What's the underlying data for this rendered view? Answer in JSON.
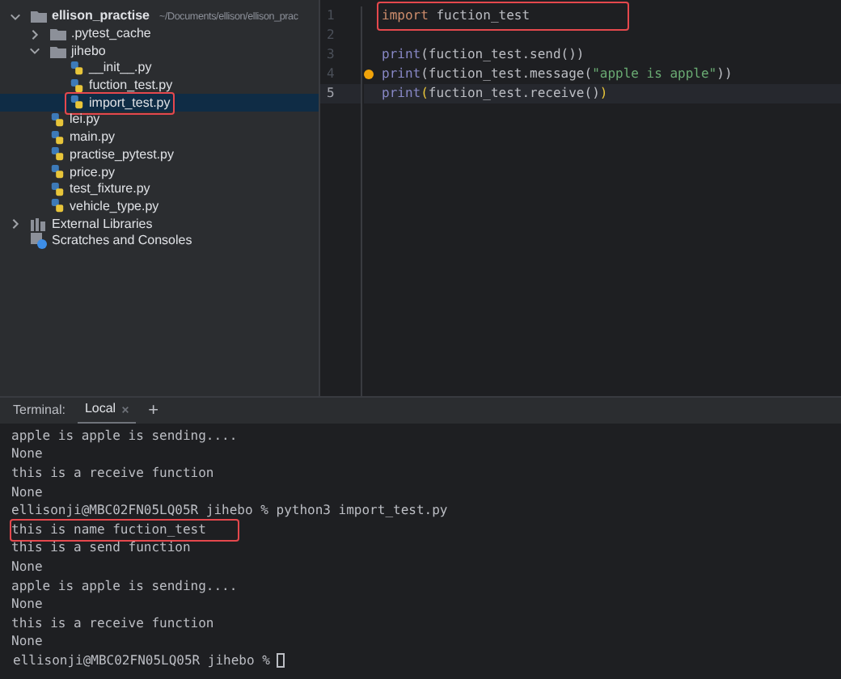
{
  "project_tree": {
    "items": [
      {
        "kind": "folder",
        "label": "ellison_practise",
        "path": "~/Documents/ellison/ellison_prac",
        "expanded": true,
        "selected": false,
        "highlighted": false,
        "children": [
          {
            "kind": "folder",
            "label": ".pytest_cache",
            "expanded": false,
            "selected": false,
            "highlighted": false
          },
          {
            "kind": "folder",
            "label": "jihebo",
            "expanded": true,
            "selected": false,
            "highlighted": false,
            "children": [
              {
                "kind": "python",
                "label": "__init__.py",
                "selected": false,
                "highlighted": false
              },
              {
                "kind": "python",
                "label": "fuction_test.py",
                "selected": false,
                "highlighted": false
              },
              {
                "kind": "python",
                "label": "import_test.py",
                "selected": true,
                "highlighted": true
              }
            ]
          },
          {
            "kind": "python",
            "label": "lei.py",
            "selected": false,
            "highlighted": false
          },
          {
            "kind": "python",
            "label": "main.py",
            "selected": false,
            "highlighted": false
          },
          {
            "kind": "python",
            "label": "practise_pytest.py",
            "selected": false,
            "highlighted": false
          },
          {
            "kind": "python",
            "label": "price.py",
            "selected": false,
            "highlighted": false
          },
          {
            "kind": "python",
            "label": "test_fixture.py",
            "selected": false,
            "highlighted": false
          },
          {
            "kind": "python",
            "label": "vehicle_type.py",
            "selected": false,
            "highlighted": false
          }
        ]
      },
      {
        "kind": "library",
        "label": "External Libraries",
        "expanded": false,
        "selected": false,
        "highlighted": false
      },
      {
        "kind": "scratches",
        "label": "Scratches and Consoles",
        "selected": false,
        "highlighted": false
      }
    ]
  },
  "editor": {
    "lines": [
      {
        "number": "1",
        "current": false,
        "highlighted": true,
        "bulb": false,
        "tokens": [
          {
            "kind": "keyword",
            "text": "import"
          },
          {
            "kind": "plain",
            "text": " fuction_test"
          }
        ]
      },
      {
        "number": "2",
        "current": false,
        "highlighted": false,
        "bulb": false
      },
      {
        "number": "3",
        "current": false,
        "highlighted": false,
        "bulb": false,
        "tokens": [
          {
            "kind": "builtin",
            "text": "print"
          },
          {
            "kind": "plain",
            "text": "(fuction_test.send())"
          }
        ]
      },
      {
        "number": "4",
        "current": false,
        "highlighted": false,
        "bulb": true,
        "tokens": [
          {
            "kind": "builtin",
            "text": "print"
          },
          {
            "kind": "plain",
            "text": "(fuction_test.message("
          },
          {
            "kind": "string",
            "text": "\"apple is apple\""
          },
          {
            "kind": "plain",
            "text": "))"
          }
        ]
      },
      {
        "number": "5",
        "current": true,
        "highlighted": false,
        "bulb": false,
        "tokens": [
          {
            "kind": "builtin",
            "text": "print"
          },
          {
            "kind": "brace",
            "text": "("
          },
          {
            "kind": "plain",
            "text": "fuction_test.receive()"
          },
          {
            "kind": "brace",
            "text": ")"
          }
        ]
      }
    ]
  },
  "terminal": {
    "label": "Terminal:",
    "tabs": [
      {
        "label": "Local",
        "selected": true
      }
    ],
    "add": "+",
    "lines": [
      {
        "text": "apple is apple is sending....",
        "highlighted": false
      },
      {
        "text": "None",
        "highlighted": false
      },
      {
        "text": "this is a receive function",
        "highlighted": false
      },
      {
        "text": "None",
        "highlighted": false
      },
      {
        "text": "ellisonji@MBC02FN05LQ05R jihebo % python3 import_test.py",
        "highlighted": false
      },
      {
        "text": "this is name fuction_test",
        "highlighted": true
      },
      {
        "text": "this is a send function",
        "highlighted": false
      },
      {
        "text": "None",
        "highlighted": false
      },
      {
        "text": "apple is apple is sending....",
        "highlighted": false
      },
      {
        "text": "None",
        "highlighted": false
      },
      {
        "text": "this is a receive function",
        "highlighted": false
      },
      {
        "text": "None",
        "highlighted": false
      }
    ],
    "prompt": "ellisonji@MBC02FN05LQ05R jihebo %"
  }
}
